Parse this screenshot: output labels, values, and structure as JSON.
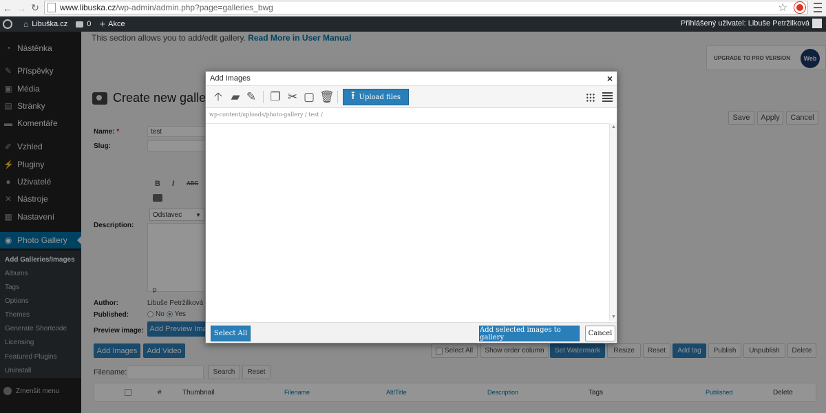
{
  "browser": {
    "url_host": "www.libuska.cz",
    "url_path": "/wp-admin/admin.php?page=galleries_bwg"
  },
  "admin_bar": {
    "site_name": "Libuška.cz",
    "comments_count": "0",
    "new_label": "Akce",
    "user_greeting": "Přihlášený uživatel: Libuše Petržilková"
  },
  "sidebar": {
    "items": [
      {
        "label": "Nástěnka",
        "icon": "dashboard-icon"
      },
      {
        "label": "Příspěvky",
        "icon": "pin-icon"
      },
      {
        "label": "Média",
        "icon": "media-icon"
      },
      {
        "label": "Stránky",
        "icon": "page-icon"
      },
      {
        "label": "Komentáře",
        "icon": "comment-icon"
      },
      {
        "label": "Vzhled",
        "icon": "brush-icon"
      },
      {
        "label": "Pluginy",
        "icon": "plugin-icon"
      },
      {
        "label": "Uživatelé",
        "icon": "users-icon"
      },
      {
        "label": "Nástroje",
        "icon": "wrench-icon"
      },
      {
        "label": "Nastavení",
        "icon": "settings-icon"
      },
      {
        "label": "Photo Gallery",
        "icon": "camera-icon"
      }
    ],
    "submenu": [
      "Add Galleries/Images",
      "Albums",
      "Tags",
      "Options",
      "Themes",
      "Generate Shortcode",
      "Licensing",
      "Featured Plugins",
      "Uninstall"
    ],
    "collapse_label": "Zmenšit menu"
  },
  "content": {
    "intro_text": "This section allows you to add/edit gallery.",
    "intro_link": "Read More in User Manual",
    "pro_banner": "UPGRADE TO PRO VERSION",
    "pro_logo": "Web",
    "page_title": "Create new galler",
    "top_buttons": {
      "save": "Save",
      "apply": "Apply",
      "cancel": "Cancel"
    },
    "labels": {
      "name": "Name:",
      "required_mark": "*",
      "slug": "Slug:",
      "description": "Description:",
      "author": "Author:",
      "published": "Published:",
      "preview_image": "Preview image:",
      "filename": "Filename:"
    },
    "name_value": "test",
    "format_select": "Odstavec",
    "path_indicator": "p",
    "author_value": "Libuše Petržilková",
    "published_no": "No",
    "published_yes": "Yes",
    "add_preview_button": "Add Preview Ima",
    "add_images_button": "Add Images",
    "add_video_button": "Add Video",
    "bulk_actions": {
      "select_all": "Select All",
      "show_order": "Show order column",
      "set_watermark": "Set Watermark",
      "resize": "Resize",
      "reset": "Reset",
      "add_tag": "Add tag",
      "publish": "Publish",
      "unpublish": "Unpublish",
      "delete": "Delete"
    },
    "search_button": "Search",
    "reset_button": "Reset",
    "table_headers": {
      "number": "#",
      "thumbnail": "Thumbnail",
      "filename": "Filename",
      "alt_title": "Alt/Title",
      "description": "Description",
      "tags": "Tags",
      "published": "Published",
      "delete": "Delete"
    }
  },
  "modal": {
    "title": "Add Images",
    "close_symbol": "×",
    "upload_button": "Upload files",
    "breadcrumb": "wp-content/uploads/photo-gallery / test /",
    "select_all_button": "Select All",
    "add_selected_button": "Add selected images to gallery",
    "cancel_button": "Cancel"
  },
  "colors": {
    "accent": "#2b7fb8",
    "wp_blue": "#0073aa",
    "sidebar_bg": "#222222",
    "admin_bar_bg": "#23282d"
  }
}
